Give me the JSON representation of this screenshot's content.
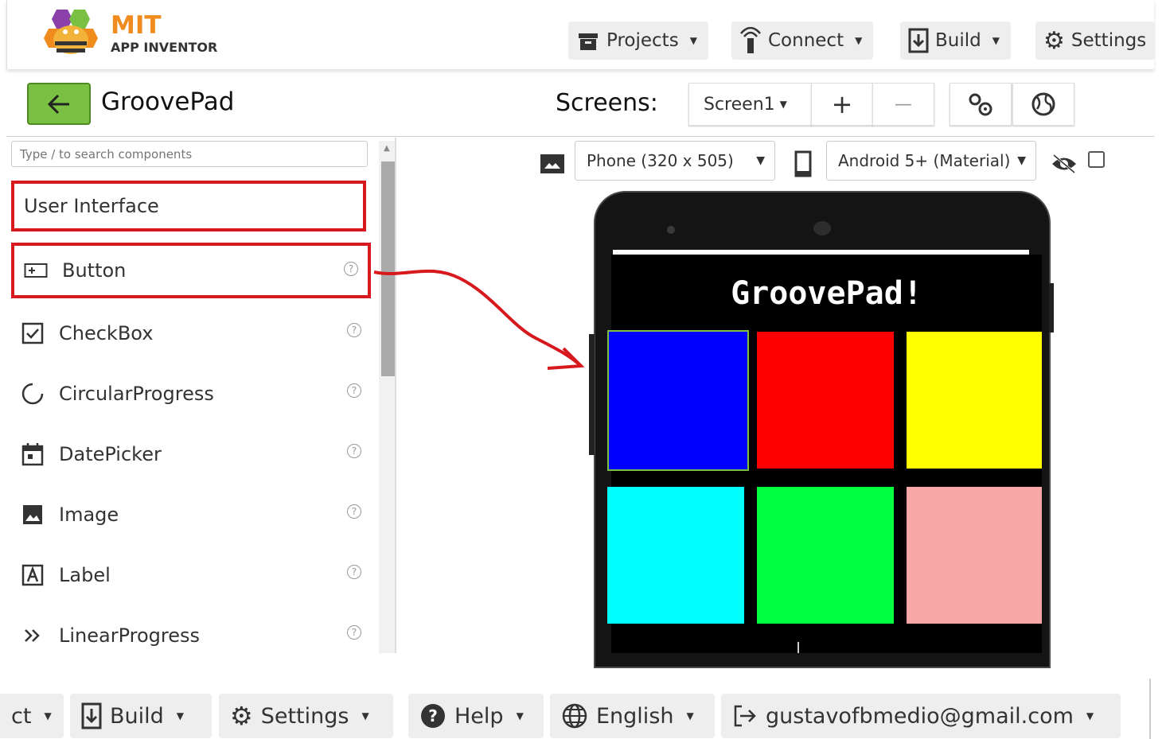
{
  "header": {
    "logo_title": "MIT",
    "logo_subtitle": "APP INVENTOR",
    "menu": {
      "projects": "Projects",
      "connect": "Connect",
      "build": "Build",
      "settings": "Settings"
    }
  },
  "project": {
    "name": "GroovePad",
    "screens_label": "Screens:",
    "current_screen": "Screen1",
    "add_screen": "+",
    "remove_screen": "—"
  },
  "palette": {
    "search_placeholder": "Type / to search components",
    "category": "User Interface",
    "help_glyph": "?",
    "components": [
      {
        "label": "Button",
        "icon": "button-icon"
      },
      {
        "label": "CheckBox",
        "icon": "checkbox-icon"
      },
      {
        "label": "CircularProgress",
        "icon": "circular-progress-icon"
      },
      {
        "label": "DatePicker",
        "icon": "calendar-icon"
      },
      {
        "label": "Image",
        "icon": "image-icon"
      },
      {
        "label": "Label",
        "icon": "label-icon"
      },
      {
        "label": "LinearProgress",
        "icon": "double-chevron-icon"
      }
    ]
  },
  "viewer": {
    "device_size": "Phone (320 x 505)",
    "theme": "Android 5+ (Material)",
    "app_title": "GroovePad!",
    "pads": [
      "#0000ff",
      "#ff0000",
      "#ffff00",
      "#00ffff",
      "#00ff40",
      "#f9a7a7"
    ]
  },
  "footer": {
    "truncated_project": "ct",
    "build": "Build",
    "settings": "Settings",
    "help": "Help",
    "language": "English",
    "account": "gustavofbmedio@gmail.com"
  },
  "colors": {
    "accent_green": "#7ac143",
    "highlight_red": "#d7191e",
    "logo_orange": "#f08c1e"
  }
}
